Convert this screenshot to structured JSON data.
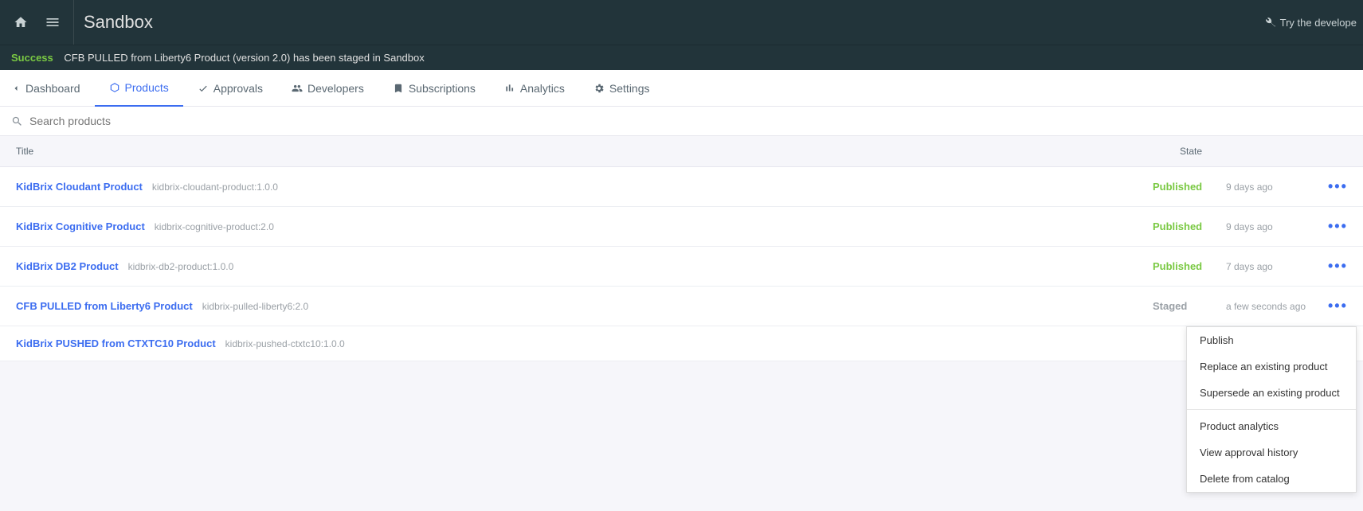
{
  "topbar": {
    "title": "Sandbox",
    "try_developer": "Try the develope"
  },
  "notice": {
    "status": "Success",
    "message": "CFB PULLED from Liberty6 Product (version 2.0) has been staged in Sandbox"
  },
  "tabs": {
    "dashboard": "Dashboard",
    "products": "Products",
    "approvals": "Approvals",
    "developers": "Developers",
    "subscriptions": "Subscriptions",
    "analytics": "Analytics",
    "settings": "Settings"
  },
  "search": {
    "placeholder": "Search products"
  },
  "headers": {
    "title": "Title",
    "state": "State"
  },
  "products": [
    {
      "name": "KidBrix Cloudant Product",
      "slug": "kidbrix-cloudant-product:1.0.0",
      "state": "Published",
      "state_class": "published",
      "time": "9 days ago"
    },
    {
      "name": "KidBrix Cognitive Product",
      "slug": "kidbrix-cognitive-product:2.0",
      "state": "Published",
      "state_class": "published",
      "time": "9 days ago"
    },
    {
      "name": "KidBrix DB2 Product",
      "slug": "kidbrix-db2-product:1.0.0",
      "state": "Published",
      "state_class": "published",
      "time": "7 days ago"
    },
    {
      "name": "CFB PULLED from Liberty6 Product",
      "slug": "kidbrix-pulled-liberty6:2.0",
      "state": "Staged",
      "state_class": "staged",
      "time": "a few seconds ago"
    },
    {
      "name": "KidBrix PUSHED from CTXTC10 Product",
      "slug": "kidbrix-pushed-ctxtc10:1.0.0",
      "state": "",
      "state_class": "",
      "time": ""
    }
  ],
  "context_menu": {
    "publish": "Publish",
    "replace": "Replace an existing product",
    "supersede": "Supersede an existing product",
    "analytics": "Product analytics",
    "history": "View approval history",
    "delete": "Delete from catalog"
  }
}
